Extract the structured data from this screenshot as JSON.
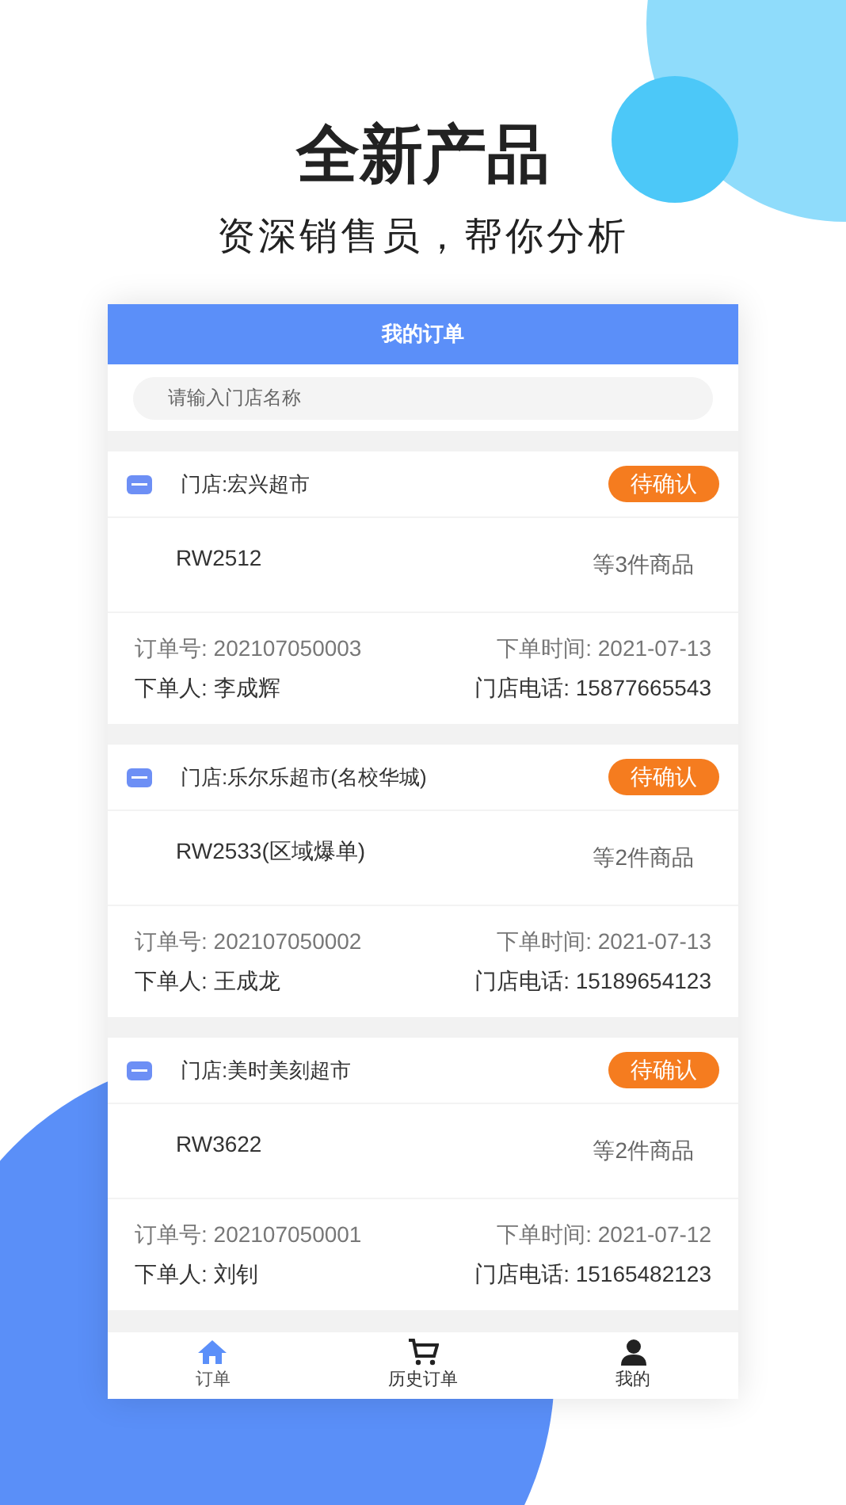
{
  "headline": "全新产品",
  "subtitle": "资深销售员，帮你分析",
  "app": {
    "title": "我的订单",
    "search": {
      "placeholder": "请输入门店名称"
    },
    "orders": [
      {
        "store": "门店:宏兴超市",
        "status": "待确认",
        "product": "RW2512",
        "count": "等3件商品",
        "order_no": "订单号: 202107050003",
        "time": "下单时间: 2021-07-13",
        "person": "下单人: 李成辉",
        "phone": "门店电话: 15877665543"
      },
      {
        "store": "门店:乐尔乐超市(名校华城)",
        "status": "待确认",
        "product": "RW2533(区域爆单)",
        "count": "等2件商品",
        "order_no": "订单号: 202107050002",
        "time": "下单时间: 2021-07-13",
        "person": "下单人: 王成龙",
        "phone": "门店电话: 15189654123"
      },
      {
        "store": "门店:美时美刻超市",
        "status": "待确认",
        "product": "RW3622",
        "count": "等2件商品",
        "order_no": "订单号: 202107050001",
        "time": "下单时间: 2021-07-12",
        "person": "下单人: 刘钊",
        "phone": "门店电话: 15165482123"
      }
    ],
    "tabs": [
      {
        "kind": "home",
        "label": "订单",
        "selected": true
      },
      {
        "kind": "cart",
        "label": "历史订单",
        "selected": false
      },
      {
        "kind": "user",
        "label": "我的",
        "selected": false
      }
    ]
  }
}
